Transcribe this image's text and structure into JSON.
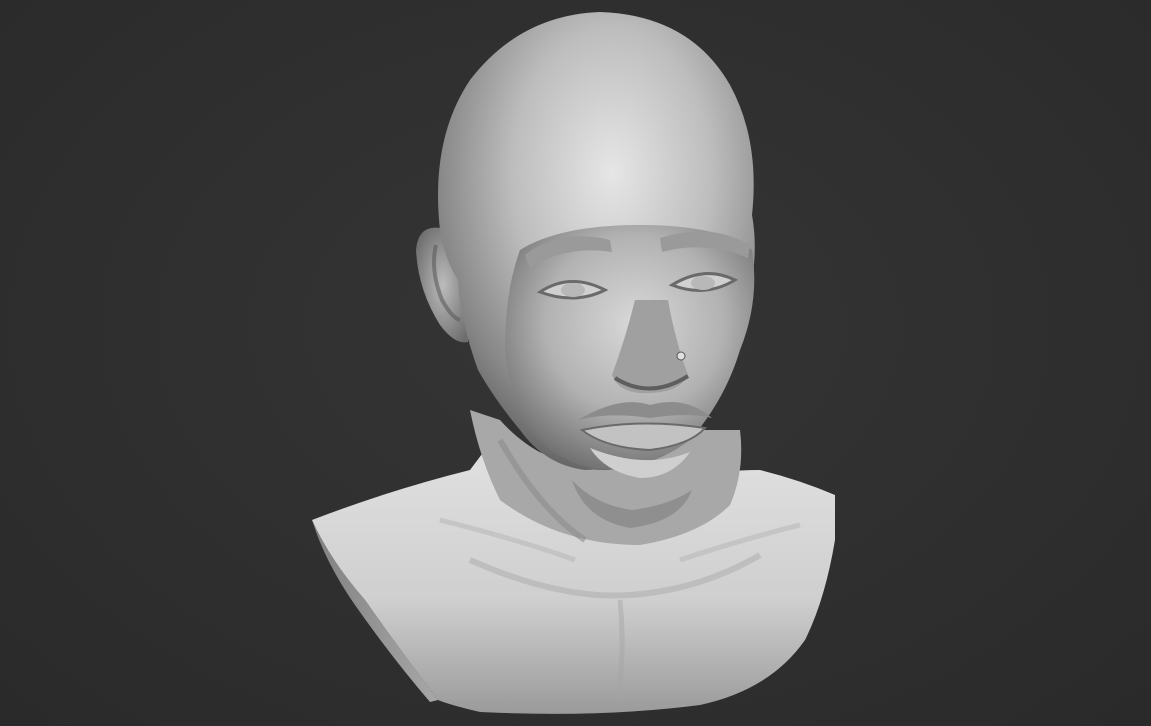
{
  "viewport": {
    "background_color": "#2e2e2e",
    "model": {
      "subject": "sculpted-bust",
      "material": "matte-grey-clay",
      "base_color": "#c9c9c9",
      "shadow_color": "#5a5a5a"
    }
  }
}
